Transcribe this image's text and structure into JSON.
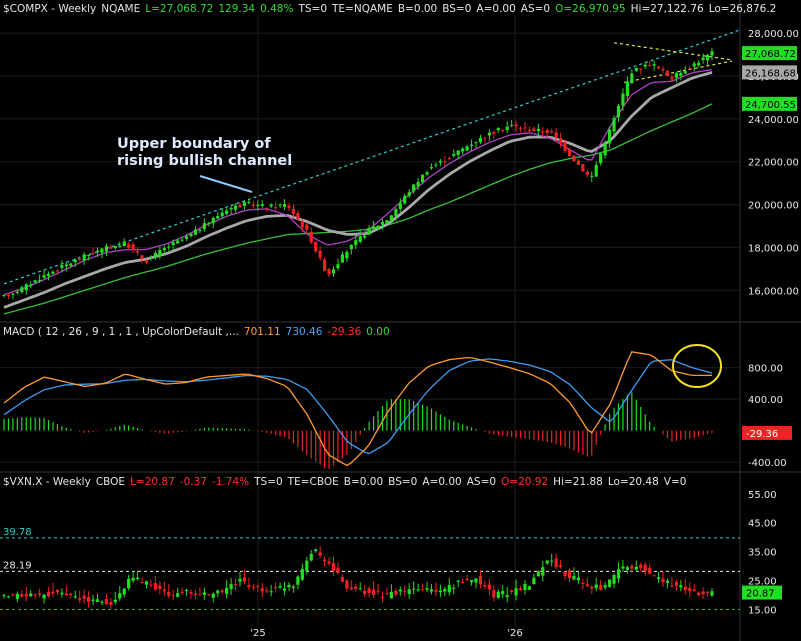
{
  "panels": {
    "price": {
      "symbol": "$COMPX - Weekly",
      "exchange": "NQAME",
      "last": "L=27,068.72",
      "change": "129.34",
      "pct": "0.48%",
      "ts": "TS=0",
      "te": "TE=NQAME",
      "b": "B=0.00",
      "bs": "BS=0",
      "a": "A=0.00",
      "as": "AS=0",
      "open": "O=26,970.95",
      "hi": "Hi=27,122.76",
      "lo": "Lo=26,876.2"
    },
    "macd": {
      "label": "MACD ( 12 , 26 , 9 , 1 , 1 , UpColorDefault ,...",
      "macd": "701.11",
      "signal": "730.46",
      "hist": "-29.36",
      "zero": "0.00"
    },
    "vxn": {
      "symbol": "$VXN.X - Weekly",
      "exchange": "CBOE",
      "last": "L=20.87",
      "change": "-0.37",
      "pct": "-1.74%",
      "ts": "TS=0",
      "te": "TE=CBOE",
      "b": "B=0.00",
      "bs": "BS=0",
      "a": "A=0.00",
      "as": "AS=0",
      "open": "O=20.92",
      "hi": "Hi=21.88",
      "lo": "Lo=20.48",
      "v": "V=0"
    }
  },
  "annotation": {
    "line1": "Upper boundary of",
    "line2": "rising bullish channel"
  },
  "colors": {
    "up": "#22dd22",
    "down": "#ee2222",
    "macd_line": "#ff9a2e",
    "signal_line": "#3f9bf0",
    "ma10": "#b040c8",
    "ma20": "#a8a8a8",
    "ma50": "#38c038",
    "channel": "#33cccc",
    "wedge": "#e6e64a",
    "circle": "#f0e020"
  },
  "chart_data": [
    {
      "type": "candlestick",
      "title": "$COMPX - Weekly NQAME",
      "ylim": [
        14800,
        28800
      ],
      "y_ticks": [
        16000,
        18000,
        20000,
        22000,
        24000,
        26000,
        28000
      ],
      "y_tick_labels": [
        "16,000.00",
        "18,000.00",
        "20,000.00",
        "22,000.00",
        "24,000.00",
        "26,000.00",
        "28,000.00"
      ],
      "x_labels": [
        "'25",
        "'26"
      ],
      "price_tags": [
        {
          "label": "27,068.72",
          "value": 27068.72,
          "color": "#22dd22"
        },
        {
          "label": "26,168.68",
          "value": 26168.68,
          "color": "#a8a8a8"
        },
        {
          "label": "24,700.55",
          "value": 24700.55,
          "color": "#22dd22"
        }
      ],
      "close_path": [
        15700,
        16150,
        16700,
        17150,
        17600,
        17950,
        18200,
        17350,
        18000,
        18450,
        19100,
        19800,
        20050,
        19900,
        20000,
        18700,
        16700,
        17900,
        18800,
        19350,
        20600,
        21700,
        22200,
        22800,
        23300,
        23700,
        23500,
        23400,
        22300,
        21200,
        23600,
        26200,
        26600,
        25900,
        26500,
        27068.72
      ],
      "ma_10_path": [
        15800,
        16100,
        16500,
        16950,
        17400,
        17750,
        17900,
        17900,
        18150,
        18550,
        19050,
        19450,
        19750,
        19800,
        19500,
        18600,
        18100,
        18300,
        18800,
        19600,
        20450,
        21250,
        21900,
        22450,
        22900,
        23250,
        23350,
        23100,
        22550,
        22000,
        23700,
        25100,
        25700,
        25750,
        26150,
        26300
      ],
      "ma_20_path": [
        15200,
        15550,
        15900,
        16300,
        16650,
        17000,
        17300,
        17450,
        17700,
        18050,
        18500,
        18900,
        19250,
        19450,
        19500,
        19200,
        18800,
        18600,
        18650,
        19100,
        19850,
        20700,
        21400,
        22000,
        22500,
        22950,
        23150,
        23150,
        22850,
        22450,
        23000,
        24100,
        25000,
        25450,
        25900,
        26168.68
      ],
      "ma_50_path": [
        14900,
        15150,
        15400,
        15700,
        16000,
        16300,
        16600,
        16850,
        17100,
        17400,
        17700,
        17950,
        18200,
        18400,
        18600,
        18650,
        18700,
        18750,
        18850,
        19050,
        19350,
        19750,
        20100,
        20500,
        20900,
        21300,
        21650,
        21950,
        22150,
        22300,
        22550,
        23000,
        23450,
        23850,
        24250,
        24700.55
      ],
      "channel_upper": {
        "start": 16300,
        "end": 28150
      },
      "wedge": {
        "top_start": 27550,
        "top_end": 26750,
        "bottom_start": 25700,
        "bottom_end": 26700
      }
    },
    {
      "type": "line",
      "title": "MACD ( 12 , 26 , 9 , 1 , 1 , UpColorDefault ,...",
      "ylim": [
        -500,
        1150
      ],
      "y_ticks": [
        -400,
        400,
        800
      ],
      "y_tick_labels": [
        "-400.00",
        "400.00",
        "800.00"
      ],
      "series": [
        {
          "name": "MACD",
          "values": [
            350,
            550,
            680,
            620,
            560,
            600,
            720,
            650,
            590,
            610,
            680,
            700,
            720,
            660,
            560,
            200,
            -300,
            -450,
            -200,
            250,
            600,
            820,
            900,
            930,
            870,
            800,
            720,
            600,
            350,
            -50,
            350,
            1000,
            960,
            760,
            700,
            701.11
          ]
        },
        {
          "name": "Signal",
          "values": [
            200,
            380,
            520,
            580,
            590,
            595,
            640,
            650,
            630,
            620,
            640,
            670,
            700,
            690,
            650,
            520,
            200,
            -150,
            -300,
            -150,
            200,
            520,
            760,
            880,
            910,
            880,
            830,
            750,
            580,
            300,
            100,
            500,
            880,
            900,
            800,
            730.46
          ]
        },
        {
          "name": "Histogram",
          "values": [
            150,
            170,
            160,
            40,
            -30,
            5,
            80,
            0,
            -40,
            -10,
            40,
            30,
            20,
            -30,
            -90,
            -320,
            -500,
            -300,
            100,
            400,
            400,
            300,
            140,
            50,
            -40,
            -80,
            -110,
            -150,
            -230,
            -350,
            250,
            500,
            80,
            -140,
            -100,
            -29.36
          ]
        }
      ],
      "value_tags": [
        {
          "label": "800.00",
          "value": 800
        },
        {
          "label": "-29.36",
          "value": -29.36,
          "color": "#ee2222"
        }
      ]
    },
    {
      "type": "candlestick",
      "title": "$VXN.X - Weekly CBOE",
      "ylim": [
        10,
        57
      ],
      "y_ticks": [
        15,
        25,
        35,
        45,
        55
      ],
      "y_tick_labels": [
        "15.00",
        "25.00",
        "35.00",
        "45.00",
        "55.00"
      ],
      "horizontal_lines": [
        {
          "label": "39.78",
          "value": 39.78,
          "color": "#33cccc"
        },
        {
          "label": "28.19",
          "value": 28.19,
          "color": "#e6e6e6"
        },
        {
          "label": "",
          "value": 15,
          "color": "#22bb22"
        }
      ],
      "close_path": [
        19,
        20,
        20,
        21,
        19,
        18,
        17,
        26,
        24,
        20,
        21,
        20,
        21,
        25,
        22,
        22,
        24,
        36,
        30,
        22,
        21,
        20,
        21,
        22,
        21,
        24,
        26,
        20,
        21,
        24,
        33,
        27,
        24,
        22,
        29,
        30,
        26,
        23,
        21,
        20.87
      ],
      "last_tag": {
        "label": "20.87",
        "value": 20.87,
        "color": "#22dd22"
      }
    }
  ]
}
